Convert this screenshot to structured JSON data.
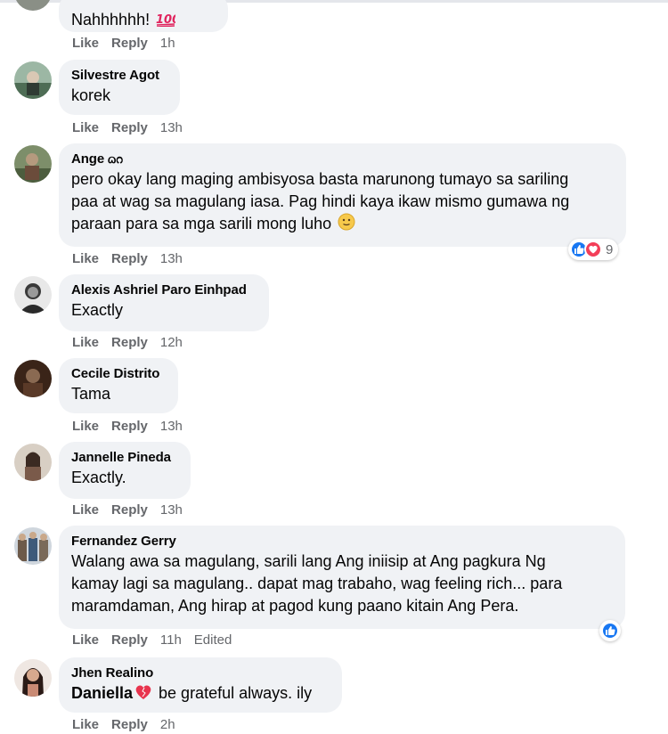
{
  "actions": {
    "like": "Like",
    "reply": "Reply",
    "edited": "Edited"
  },
  "comments": [
    {
      "author": "",
      "text": "Nahhhhhh!",
      "emoji": "100-emoji",
      "time": "1h"
    },
    {
      "author": "Silvestre Agot",
      "text": "korek",
      "time": "13h"
    },
    {
      "author": "Ange ᦒᦅ",
      "text_lines": [
        "pero okay lang maging ambisyosa basta marunong tumayo sa sariling",
        "paa at wag sa magulang iasa. Pag hindi kaya ikaw mismo gumawa ng",
        "paraan para sa mga sarili mong luho"
      ],
      "emoji": "slight-smile-emoji",
      "time": "13h",
      "reactions": {
        "icons": [
          "like-icon",
          "love-icon"
        ],
        "count": "9"
      }
    },
    {
      "author": "Alexis Ashriel Paro Einhpad",
      "text": "Exactly",
      "time": "12h"
    },
    {
      "author": "Cecile Distrito",
      "text": "Tama",
      "time": "13h"
    },
    {
      "author": "Jannelle Pineda",
      "text": "Exactly.",
      "time": "13h"
    },
    {
      "author": "Fernandez Gerry",
      "text_lines": [
        "Walang awa sa magulang, sarili lang Ang iniisip at Ang pagkura Ng",
        "kamay lagi sa magulang.. dapat mag trabaho, wag feeling rich... para",
        "maramdaman, Ang hirap at pagod kung paano kitain Ang Pera."
      ],
      "time": "11h",
      "edited": true,
      "reactions": {
        "icons": [
          "like-icon"
        ],
        "count": ""
      }
    },
    {
      "author": "Jhen Realino",
      "mention": "Daniella",
      "emoji": "heart-emoji",
      "text": " be grateful always. ily",
      "time": "2h"
    }
  ],
  "colors": {
    "bubble": "#f0f2f5",
    "meta": "#65676b",
    "like": "#1877f2",
    "love": "#f33e58"
  }
}
